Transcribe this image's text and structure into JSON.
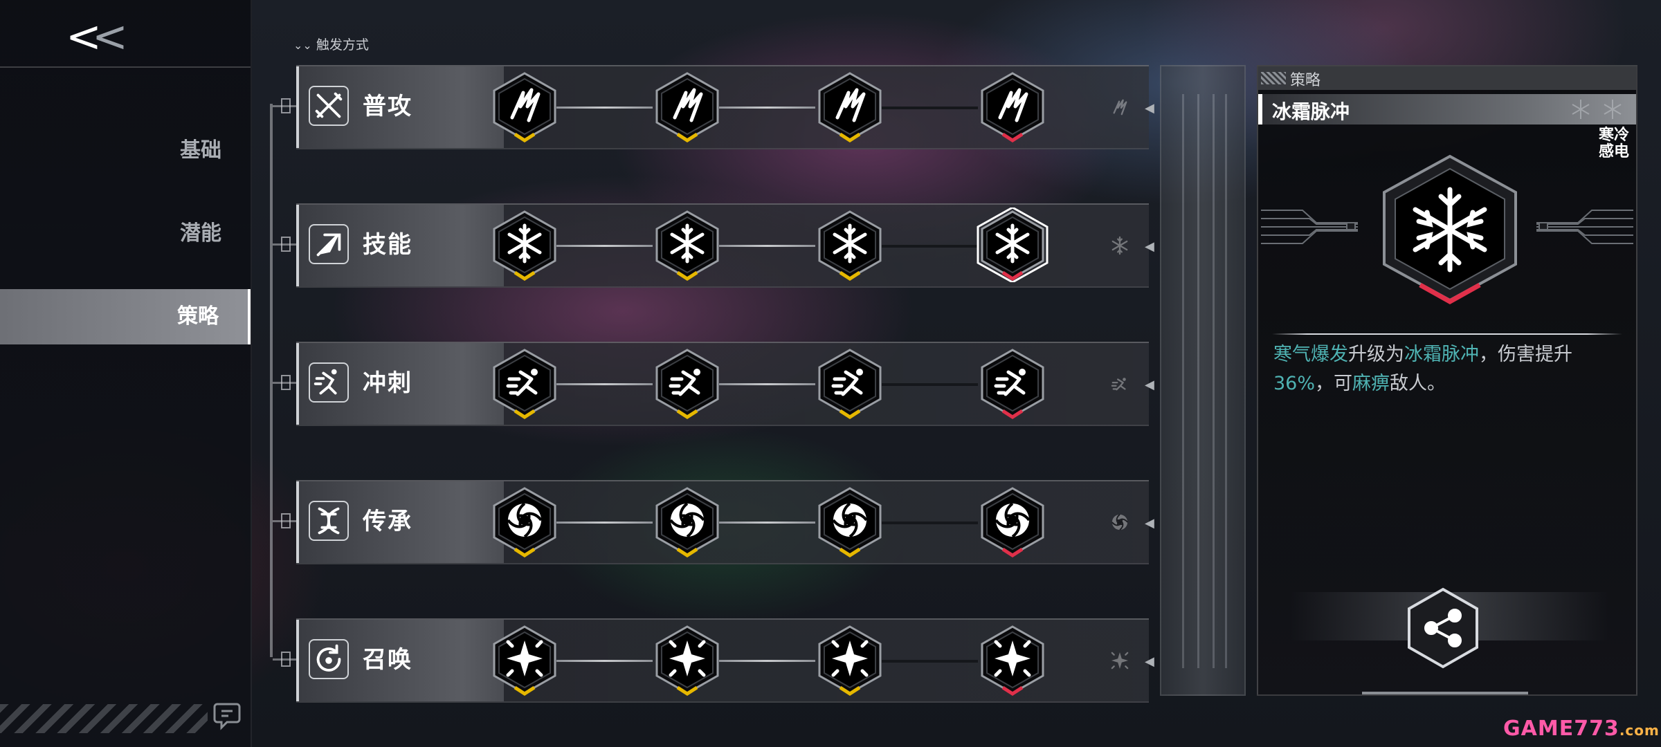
{
  "sidebar": {
    "back_label": "<<",
    "nav": [
      {
        "label": "基础",
        "active": false
      },
      {
        "label": "潜能",
        "active": false
      },
      {
        "label": "策略",
        "active": true
      }
    ]
  },
  "trigger": {
    "label": "触发方式"
  },
  "rows": [
    {
      "title": "普攻",
      "icon": "crossed-swords-icon",
      "node_icon": "claw-slash-icon",
      "nodes": [
        {
          "state": "yellow"
        },
        {
          "state": "yellow"
        },
        {
          "state": "yellow"
        },
        {
          "state": "red"
        }
      ]
    },
    {
      "title": "技能",
      "icon": "arrow-up-right-icon",
      "node_icon": "snowflake-icon",
      "nodes": [
        {
          "state": "yellow"
        },
        {
          "state": "yellow"
        },
        {
          "state": "yellow"
        },
        {
          "state": "red-selected"
        }
      ]
    },
    {
      "title": "冲刺",
      "icon": "dash-runner-icon",
      "node_icon": "dash-runner-icon",
      "nodes": [
        {
          "state": "yellow"
        },
        {
          "state": "yellow"
        },
        {
          "state": "yellow"
        },
        {
          "state": "red"
        }
      ]
    },
    {
      "title": "传承",
      "icon": "dna-helix-icon",
      "node_icon": "vortex-icon",
      "nodes": [
        {
          "state": "yellow"
        },
        {
          "state": "yellow"
        },
        {
          "state": "yellow"
        },
        {
          "state": "red"
        }
      ]
    },
    {
      "title": "召唤",
      "icon": "summon-cycle-icon",
      "node_icon": "sparkle-star-icon",
      "nodes": [
        {
          "state": "yellow"
        },
        {
          "state": "yellow"
        },
        {
          "state": "yellow"
        },
        {
          "state": "red"
        }
      ]
    }
  ],
  "detail": {
    "tab_label": "策略",
    "skill_name": "冰霜脉冲",
    "tags": [
      "寒冷",
      "感电"
    ],
    "desc_parts": [
      {
        "text": "寒气爆发",
        "hl": true
      },
      {
        "text": "升级为",
        "hl": false
      },
      {
        "text": "冰霜脉冲",
        "hl": true
      },
      {
        "text": "，伤害提升",
        "hl": false
      },
      {
        "text": "36%",
        "hl": true
      },
      {
        "text": "，可",
        "hl": false
      },
      {
        "text": "麻痹",
        "hl": true
      },
      {
        "text": "敌人。",
        "hl": false
      }
    ],
    "share_icon": "share-icon"
  },
  "colors": {
    "accent_yellow": "#e6b800",
    "accent_red": "#e0304a",
    "highlight_teal": "#4fb3b3"
  },
  "watermark": {
    "main": "GAME773",
    "suffix": ".com"
  }
}
